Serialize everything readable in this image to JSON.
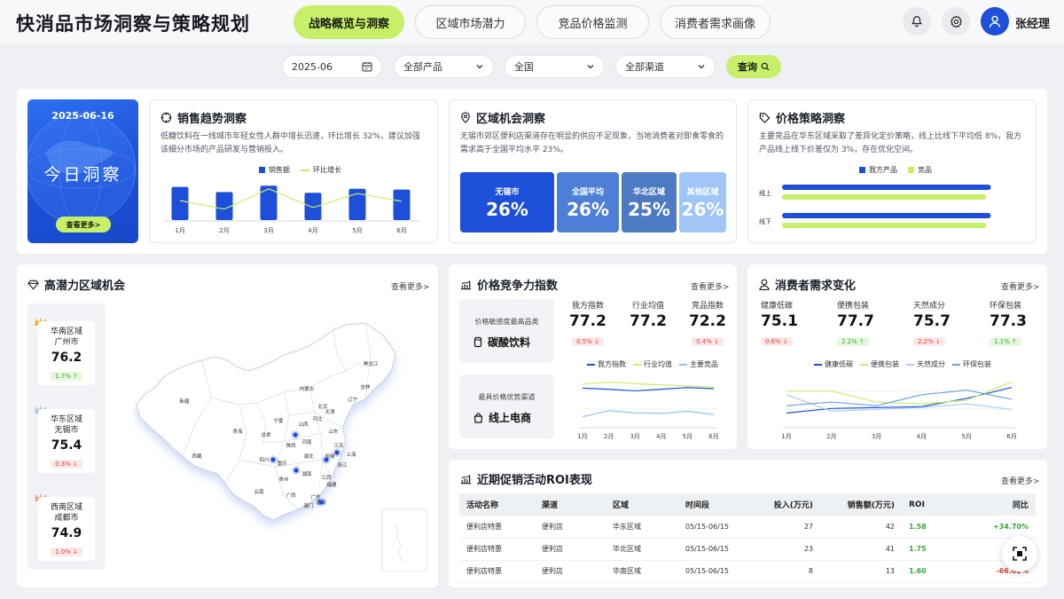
{
  "header": {
    "title": "快消品市场洞察与策略规划",
    "tabs": [
      {
        "label": "战略概览与洞察",
        "active": true
      },
      {
        "label": "区域市场潜力",
        "active": false
      },
      {
        "label": "竞品价格监测",
        "active": false
      },
      {
        "label": "消费者需求画像",
        "active": false
      }
    ],
    "user": "张经理",
    "accent": "#c8ef6a",
    "brand": "#1d4fd8"
  },
  "filters": {
    "date": "2025-06",
    "product": "全部产品",
    "region": "全国",
    "channel": "全部渠道",
    "query_label": "查询"
  },
  "today": {
    "date": "2025-06-16",
    "title": "今日洞察",
    "more": "查看更多>"
  },
  "sales_insight": {
    "title": "销售趋势洞察",
    "desc": "低糖饮料在一线城市年轻女性人群中增长迅速，环比增长 32%，建议加强该细分市场的产品研发与营销投入。"
  },
  "region_insight": {
    "title": "区域机会洞察",
    "desc": "无锡市郊区便利店渠道存在明显的供应不足现象，当地消费者对即食零食的需求高于全国平均水平 23%。",
    "stats": [
      {
        "label": "无锡市",
        "value": "26%"
      },
      {
        "label": "全国平均",
        "value": "26%"
      },
      {
        "label": "华北区域",
        "value": "25%"
      },
      {
        "label": "其他区域",
        "value": "26%"
      }
    ]
  },
  "price_insight": {
    "title": "价格策略洞察",
    "desc": "主要竞品在华东区域采取了差异化定价策略，线上比线下平均低 8%，我方产品线上线下价差仅为 3%，存在优化空间。"
  },
  "potential": {
    "title": "高潜力区域机会",
    "more": "查看更多>",
    "regions": [
      {
        "line1": "华南区域",
        "line2": "广州市",
        "value": "76.2",
        "badge": "1.7% ↑",
        "dir": "up",
        "crown": "#f3b73c"
      },
      {
        "line1": "华东区域",
        "line2": "无锡市",
        "value": "75.4",
        "badge": "0.3% ↓",
        "dir": "down",
        "crown": "#b9c8dc"
      },
      {
        "line1": "西南区域",
        "line2": "成都市",
        "value": "74.9",
        "badge": "1.0% ↓",
        "dir": "down",
        "crown": "#e9a99a"
      }
    ],
    "map_labels": [
      "新疆",
      "西藏",
      "青海",
      "甘肃",
      "内蒙古",
      "黑龙江",
      "吉林",
      "辽宁",
      "北京",
      "天津",
      "河北",
      "山西",
      "宁夏",
      "陕西",
      "山东",
      "河南",
      "四川",
      "重庆",
      "湖北",
      "安徽",
      "江苏",
      "上海",
      "浙江",
      "贵州",
      "湖南",
      "江西",
      "福建",
      "云南",
      "广西",
      "广东",
      "澳门",
      "香港"
    ]
  },
  "competitiveness": {
    "title": "价格竞争力指数",
    "more": "查看更多>",
    "box1_label": "价格敏感度最高品类",
    "box1_value": "碳酸饮料",
    "box2_label": "最具价格优势渠道",
    "box2_value": "线上电商",
    "metrics": [
      {
        "label": "我方指数",
        "value": "77.2",
        "badge": "0.5% ↓",
        "dir": "down"
      },
      {
        "label": "行业均值",
        "value": "77.2",
        "badge": "",
        "dir": ""
      },
      {
        "label": "竞品指数",
        "value": "72.2",
        "badge": "0.4% ↓",
        "dir": "down"
      }
    ]
  },
  "consumer": {
    "title": "消费者需求变化",
    "more": "查看更多>",
    "metrics": [
      {
        "label": "健康低碳",
        "value": "75.1",
        "badge": "0.6% ↓",
        "dir": "down"
      },
      {
        "label": "便携包装",
        "value": "77.7",
        "badge": "2.2% ↑",
        "dir": "up"
      },
      {
        "label": "天然成分",
        "value": "75.7",
        "badge": "2.2% ↓",
        "dir": "down"
      },
      {
        "label": "环保包装",
        "value": "77.3",
        "badge": "1.1% ↑",
        "dir": "up"
      }
    ]
  },
  "roi": {
    "title": "近期促销活动ROI表现",
    "more": "查看更多>",
    "columns": [
      "活动名称",
      "渠道",
      "区域",
      "时间段",
      "投入(万元)",
      "销售额(万元)",
      "ROI",
      "同比"
    ],
    "rows": [
      [
        "便利店特惠",
        "便利店",
        "华东区域",
        "05/15-06/15",
        "27",
        "42",
        "1.58",
        "+34.70%"
      ],
      [
        "便利店特惠",
        "便利店",
        "华北区域",
        "05/15-06/15",
        "23",
        "41",
        "1.75",
        "+32.2"
      ],
      [
        "便利店特惠",
        "便利店",
        "华南区域",
        "05/15-06/15",
        "8",
        "13",
        "1.60",
        "-66.02%"
      ]
    ]
  },
  "chart_data": [
    {
      "type": "bar",
      "categories": [
        "1月",
        "2月",
        "3月",
        "4月",
        "5月",
        "6月"
      ],
      "series": [
        {
          "name": "销售额",
          "values": [
            85,
            72,
            88,
            70,
            80,
            78
          ],
          "color": "#1d4fd8"
        },
        {
          "name": "环比增长",
          "values": [
            50,
            28,
            80,
            32,
            68,
            48
          ],
          "color": "#c8ef6a",
          "kind": "line"
        }
      ],
      "ylim": [
        0,
        100
      ]
    },
    {
      "type": "bar",
      "orientation": "horizontal",
      "categories": [
        "线上",
        "线下"
      ],
      "series": [
        {
          "name": "我方产品",
          "values": [
            92,
            92
          ],
          "color": "#1d4fd8"
        },
        {
          "name": "竞品",
          "values": [
            90,
            90
          ],
          "color": "#c8ef6a"
        }
      ],
      "xlim": [
        0,
        100
      ]
    },
    {
      "type": "line",
      "categories": [
        "1月",
        "2月",
        "3月",
        "4月",
        "5月",
        "6月"
      ],
      "series": [
        {
          "name": "我方指数",
          "values": [
            77.2,
            77.0,
            76.7,
            77.0,
            77.3,
            77.1
          ],
          "color": "#1d4fd8"
        },
        {
          "name": "行业均值",
          "values": [
            77.9,
            78.3,
            78.0,
            77.8,
            77.6,
            77.4
          ],
          "color": "#c8ef6a"
        },
        {
          "name": "主要竞品",
          "values": [
            72.0,
            73.1,
            72.7,
            72.6,
            73.0,
            72.4
          ],
          "color": "#8fc3ef"
        }
      ],
      "ylim": [
        70,
        80
      ]
    },
    {
      "type": "line",
      "categories": [
        "1月",
        "2月",
        "3月",
        "4月",
        "5月",
        "6月"
      ],
      "series": [
        {
          "name": "健康低碳",
          "values": [
            74.6,
            75.1,
            75.2,
            75.3,
            76.2,
            77.4
          ],
          "color": "#1d4fd8"
        },
        {
          "name": "便携包装",
          "values": [
            77.0,
            77.0,
            75.8,
            75.6,
            76.0,
            78.0
          ],
          "color": "#c8ef6a"
        },
        {
          "name": "天然成分",
          "values": [
            76.6,
            74.8,
            75.0,
            75.2,
            75.6,
            75.0
          ],
          "color": "#a9cdf1"
        },
        {
          "name": "环保包装",
          "values": [
            75.4,
            75.8,
            75.4,
            76.6,
            77.1,
            76.1
          ],
          "color": "#6aa3ea"
        }
      ],
      "ylim": [
        73,
        79
      ]
    }
  ]
}
